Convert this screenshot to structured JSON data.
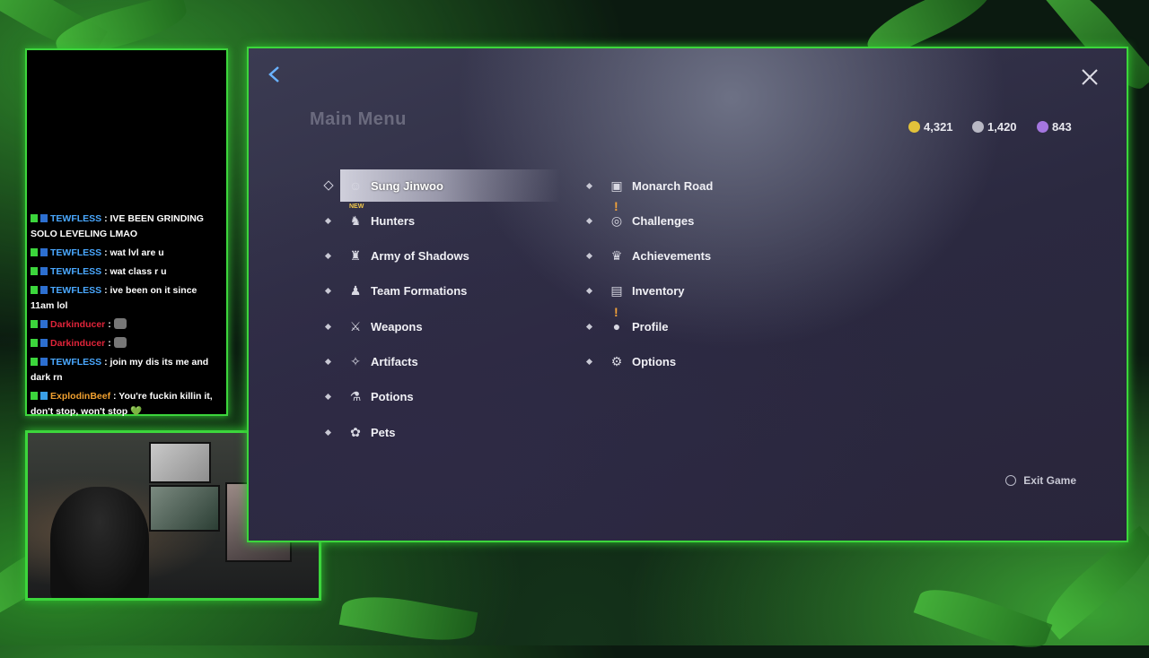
{
  "chat": {
    "messages": [
      {
        "user": "TEWFLESS",
        "color": "#4aa8ff",
        "text": "IVE BEEN GRINDING SOLO LEVELING LMAO"
      },
      {
        "user": "TEWFLESS",
        "color": "#4aa8ff",
        "text": "wat lvl are u"
      },
      {
        "user": "TEWFLESS",
        "color": "#4aa8ff",
        "text": "wat class r u"
      },
      {
        "user": "TEWFLESS",
        "color": "#4aa8ff",
        "text": "ive been on it since 11am lol"
      },
      {
        "user": "Darkinducer",
        "color": "#e0243a",
        "text": ""
      },
      {
        "user": "Darkinducer",
        "color": "#e0243a",
        "text": ""
      },
      {
        "user": "TEWFLESS",
        "color": "#4aa8ff",
        "text": "join my dis its me and dark rn"
      },
      {
        "user": "ExplodinBeef",
        "color": "#f0a030",
        "text": "You're fuckin killin it, don't stop, won't stop 💚"
      }
    ]
  },
  "game": {
    "title": "Main Menu",
    "currencies": [
      {
        "icon": "gold-coin-icon",
        "value": "4,321",
        "color": "#e2c23a"
      },
      {
        "icon": "silver-crystal-icon",
        "value": "1,420",
        "color": "#b8b8c4"
      },
      {
        "icon": "purple-gem-icon",
        "value": "843",
        "color": "#a476e0"
      }
    ],
    "left_menu": [
      {
        "label": "Sung Jinwoo",
        "icon": "jinwoo-icon",
        "glyph": "☺",
        "selected": true
      },
      {
        "label": "Hunters",
        "icon": "hunters-icon",
        "glyph": "♞",
        "new": "NEW"
      },
      {
        "label": "Army of Shadows",
        "icon": "shadows-icon",
        "glyph": "♜"
      },
      {
        "label": "Team Formations",
        "icon": "team-icon",
        "glyph": "♟"
      },
      {
        "label": "Weapons",
        "icon": "sword-icon",
        "glyph": "⚔"
      },
      {
        "label": "Artifacts",
        "icon": "artifact-icon",
        "glyph": "✧"
      },
      {
        "label": "Potions",
        "icon": "potion-icon",
        "glyph": "⚗"
      },
      {
        "label": "Pets",
        "icon": "paw-icon",
        "glyph": "✿"
      }
    ],
    "right_menu": [
      {
        "label": "Monarch Road",
        "icon": "road-icon",
        "glyph": "▣"
      },
      {
        "label": "Challenges",
        "icon": "challenge-icon",
        "glyph": "◎",
        "alert": "!"
      },
      {
        "label": "Achievements",
        "icon": "trophy-icon",
        "glyph": "♛"
      },
      {
        "label": "Inventory",
        "icon": "bag-icon",
        "glyph": "▤"
      },
      {
        "label": "Profile",
        "icon": "profile-icon",
        "glyph": "●",
        "alert": "!"
      },
      {
        "label": "Options",
        "icon": "gear-icon",
        "glyph": "⚙"
      }
    ],
    "exit_label": "Exit Game"
  }
}
